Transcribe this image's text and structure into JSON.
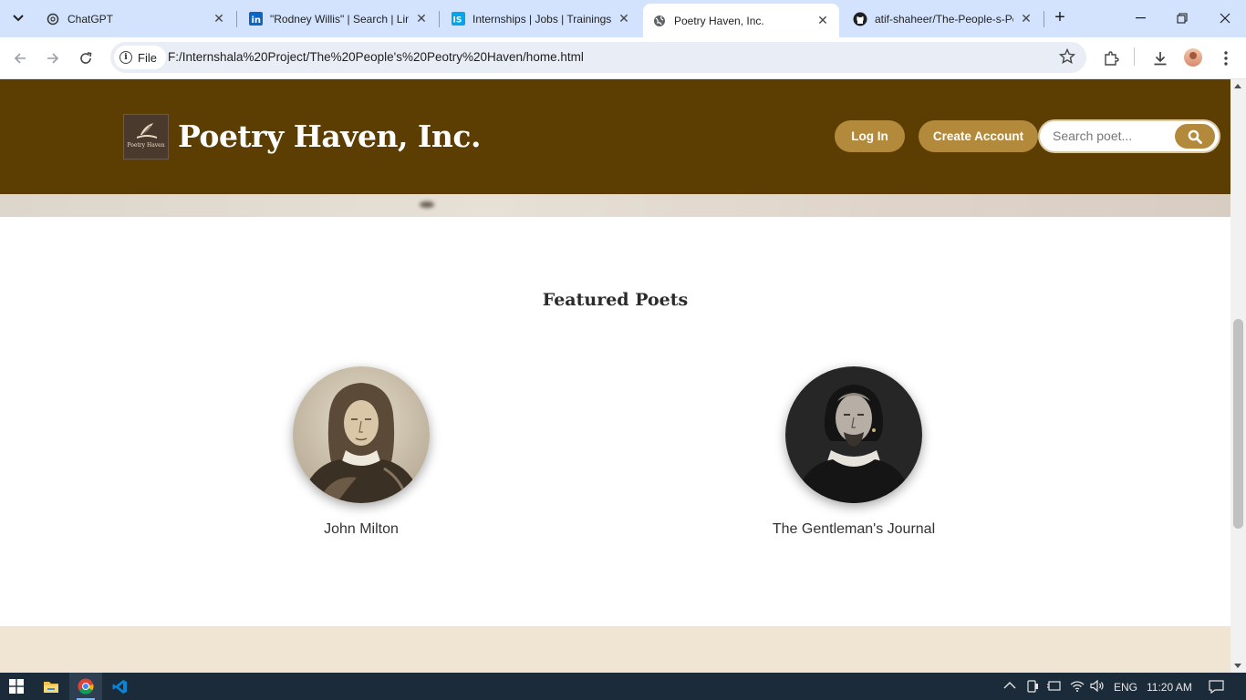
{
  "browser": {
    "tabs": [
      {
        "title": "ChatGPT",
        "icon": "chatgpt-icon",
        "active": false
      },
      {
        "title": "\"Rodney Willis\" | Search | LinkedIn",
        "icon": "linkedin-icon",
        "active": false
      },
      {
        "title": "Internships | Jobs | Trainings",
        "icon": "internshala-icon",
        "active": false
      },
      {
        "title": "Poetry Haven, Inc.",
        "icon": "globe-icon",
        "active": true
      },
      {
        "title": "atif-shaheer/The-People-s-Poetry-Haven",
        "icon": "github-icon",
        "active": false
      }
    ],
    "address": {
      "chip_label": "File",
      "url": "F:/Internshala%20Project/The%20People's%20Peotry%20Haven/home.html"
    }
  },
  "site": {
    "logo_text": "Poetry Haven",
    "title": "Poetry Haven, Inc.",
    "login_label": "Log In",
    "create_account_label": "Create Account",
    "search_placeholder": "Search poet...",
    "accent_color": "#b38a3b",
    "header_color": "#5c3d02"
  },
  "featured": {
    "title": "Featured Poets",
    "poets": [
      {
        "name": "John Milton"
      },
      {
        "name": "The Gentleman's Journal"
      }
    ]
  },
  "taskbar": {
    "language": "ENG",
    "time": "11:20 AM"
  }
}
